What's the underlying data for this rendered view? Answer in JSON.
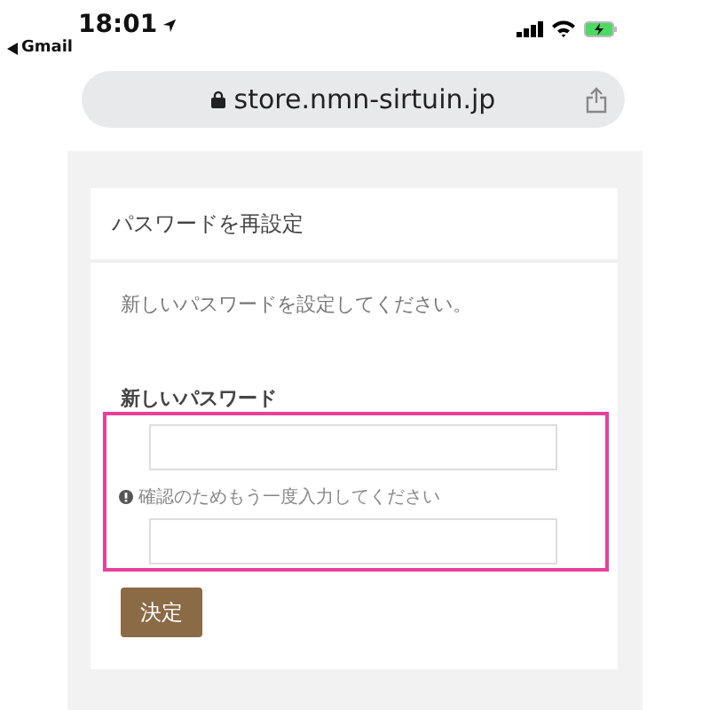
{
  "status_bar": {
    "time": "18:01",
    "back_app": "Gmail"
  },
  "address_bar": {
    "url": "store.nmn-sirtuin.jp"
  },
  "card": {
    "title": "パスワードを再設定",
    "message": "新しいパスワードを設定してください。",
    "field_label": "新しいパスワード",
    "hint": "確認のためもう一度入力してください",
    "highlighted": true,
    "submit": "決定"
  }
}
